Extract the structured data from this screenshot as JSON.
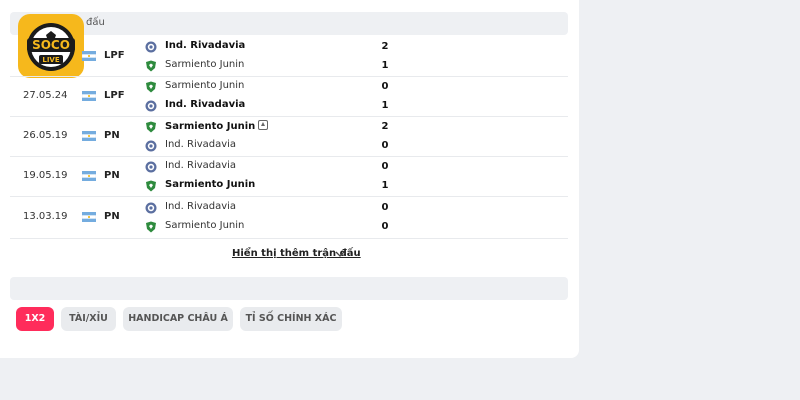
{
  "section_title": "đấu",
  "logo_text": "SOCO LIVE",
  "matches": [
    {
      "date": "",
      "league": "LPF",
      "home": "Ind. Rivadavia",
      "away": "Sarmiento Junin",
      "home_score": "2",
      "away_score": "1",
      "winner": "home",
      "home_icon": "rivadavia-crest",
      "away_icon": "sarmiento-crest",
      "promo": false
    },
    {
      "date": "27.05.24",
      "league": "LPF",
      "home": "Sarmiento Junin",
      "away": "Ind. Rivadavia",
      "home_score": "0",
      "away_score": "1",
      "winner": "away",
      "home_icon": "sarmiento-crest",
      "away_icon": "rivadavia-crest",
      "promo": false
    },
    {
      "date": "26.05.19",
      "league": "PN",
      "home": "Sarmiento Junin",
      "away": "Ind. Rivadavia",
      "home_score": "2",
      "away_score": "0",
      "winner": "home",
      "home_icon": "sarmiento-crest",
      "away_icon": "rivadavia-crest",
      "promo": true
    },
    {
      "date": "19.05.19",
      "league": "PN",
      "home": "Ind. Rivadavia",
      "away": "Sarmiento Junin",
      "home_score": "0",
      "away_score": "1",
      "winner": "away",
      "home_icon": "rivadavia-crest",
      "away_icon": "sarmiento-crest",
      "promo": false
    },
    {
      "date": "13.03.19",
      "league": "PN",
      "home": "Ind. Rivadavia",
      "away": "Sarmiento Junin",
      "home_score": "0",
      "away_score": "0",
      "winner": "none",
      "home_icon": "rivadavia-crest",
      "away_icon": "sarmiento-crest",
      "promo": false
    }
  ],
  "show_more_label": "Hiển thị thêm trận đấu",
  "odds_tabs": [
    {
      "label": "1X2",
      "active": true
    },
    {
      "label": "TÀI/XỈU",
      "active": false
    },
    {
      "label": "HANDICAP CHÂU Á",
      "active": false
    },
    {
      "label": "TỈ SỐ CHÍNH XÁC",
      "active": false
    }
  ],
  "colors": {
    "accent": "#ff2c5b",
    "logo_bg": "#f6b81c",
    "rivadavia": "#5b6fa0",
    "sarmiento": "#2e8b3e",
    "flag_blue": "#74acdf"
  }
}
